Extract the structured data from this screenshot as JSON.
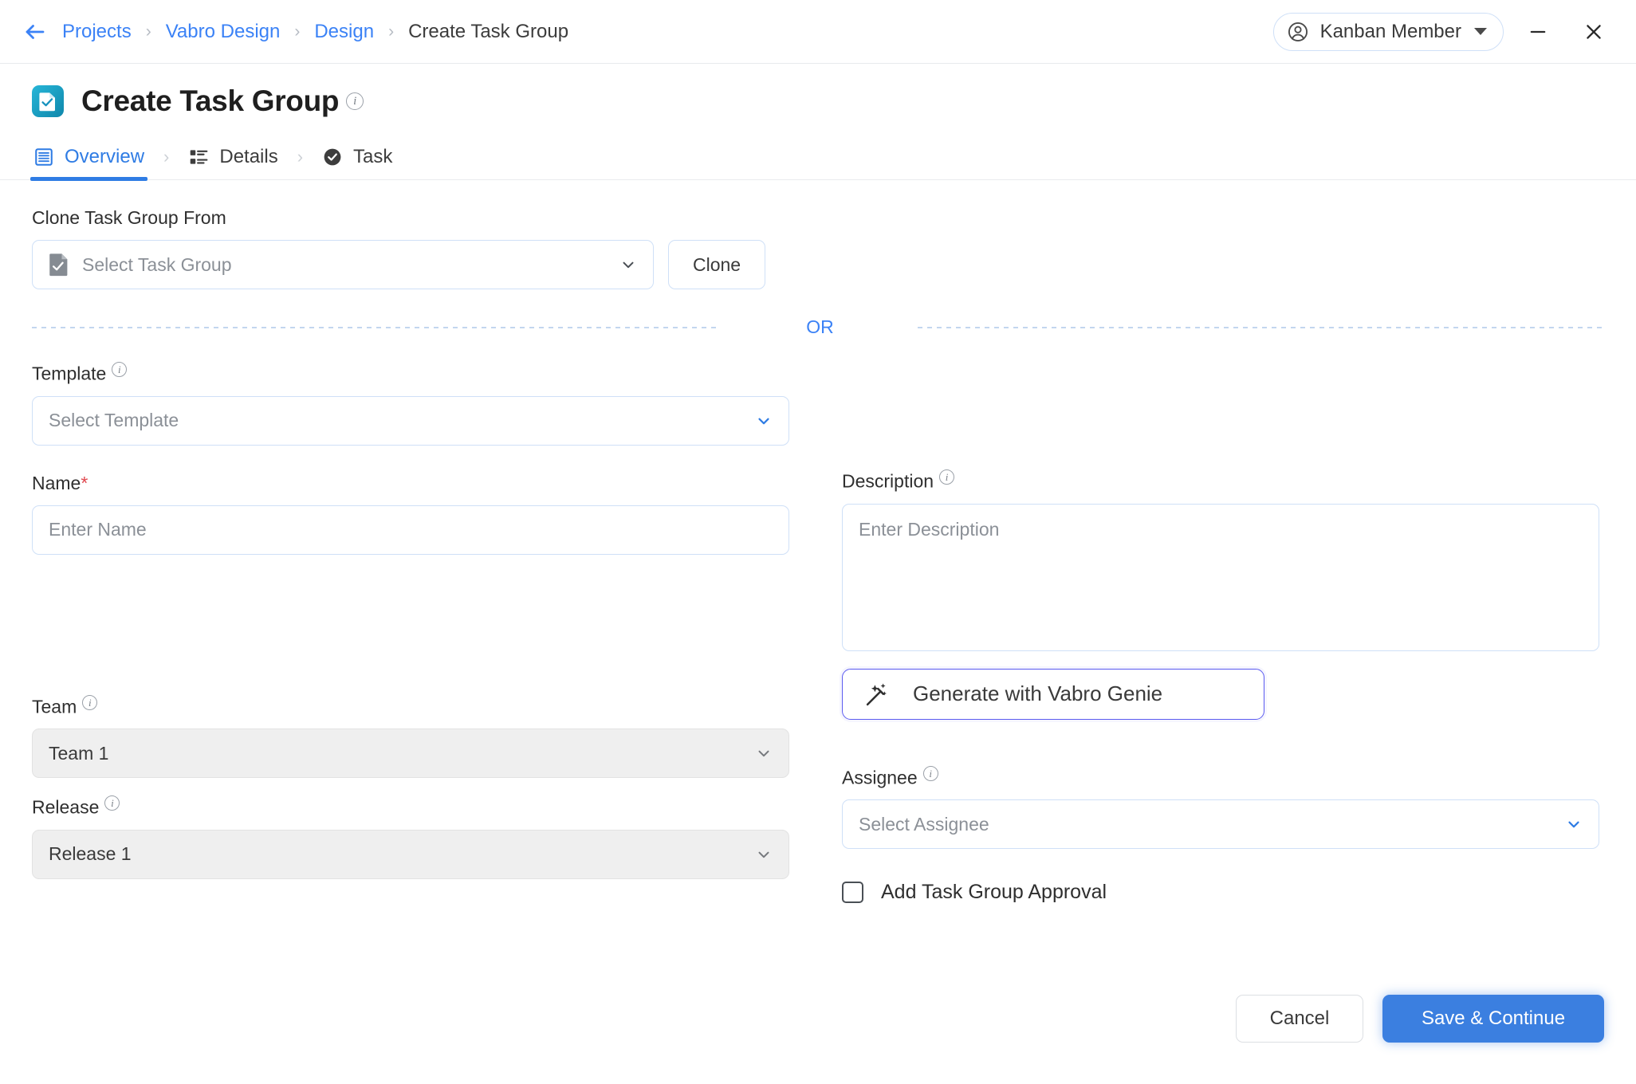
{
  "window": {
    "back_icon": "back-arrow-icon",
    "minimize_label": "—",
    "close_label": "✕"
  },
  "breadcrumb": {
    "items": [
      {
        "label": "Projects",
        "active": false
      },
      {
        "label": "Vabro Design",
        "active": false
      },
      {
        "label": "Design",
        "active": false
      },
      {
        "label": "Create Task Group",
        "active": true
      }
    ],
    "separator": "›"
  },
  "user": {
    "name": "Kanban Member",
    "avatar_icon": "user-circle-icon",
    "caret_icon": "chevron-down-icon"
  },
  "header": {
    "title": "Create Task Group",
    "icon": "task-group-document-check-icon",
    "info_tooltip": "i"
  },
  "tabs": [
    {
      "label": "Overview",
      "icon": "list-lines-icon",
      "active": true
    },
    {
      "label": "Details",
      "icon": "list-blocks-icon",
      "active": false
    },
    {
      "label": "Task",
      "icon": "check-circle-icon",
      "active": false
    }
  ],
  "clone": {
    "label": "Clone Task Group From",
    "select_placeholder": "Select Task Group",
    "select_icon": "document-check-icon",
    "chevron_icon": "chevron-down-icon",
    "button_label": "Clone"
  },
  "divider": {
    "or_label": "OR"
  },
  "template": {
    "label": "Template",
    "info": "i",
    "placeholder": "Select Template",
    "chevron_icon": "chevron-down-icon"
  },
  "name": {
    "label": "Name",
    "required_mark": "*",
    "placeholder": "Enter Name",
    "value": ""
  },
  "description": {
    "label": "Description",
    "info": "i",
    "placeholder": "Enter Description",
    "value": ""
  },
  "genie": {
    "label": "Generate with Vabro Genie",
    "icon": "magic-wand-sparkle-icon"
  },
  "team": {
    "label": "Team",
    "info": "i",
    "value": "Team 1",
    "chevron_icon": "chevron-down-icon"
  },
  "release": {
    "label": "Release",
    "info": "i",
    "value": "Release 1",
    "chevron_icon": "chevron-down-icon"
  },
  "assignee": {
    "label": "Assignee",
    "info": "i",
    "placeholder": "Select Assignee",
    "chevron_icon": "chevron-down-icon"
  },
  "approval": {
    "label": "Add Task Group Approval",
    "checked": false
  },
  "footer": {
    "cancel_label": "Cancel",
    "save_label": "Save & Continue"
  },
  "colors": {
    "accent_blue": "#3b82f6",
    "primary_button": "#3b7fe0",
    "genie_border": "#5b5bf0",
    "required_red": "#e0484f",
    "title_icon_from": "#27b6d8",
    "title_icon_to": "#0f87ab"
  }
}
